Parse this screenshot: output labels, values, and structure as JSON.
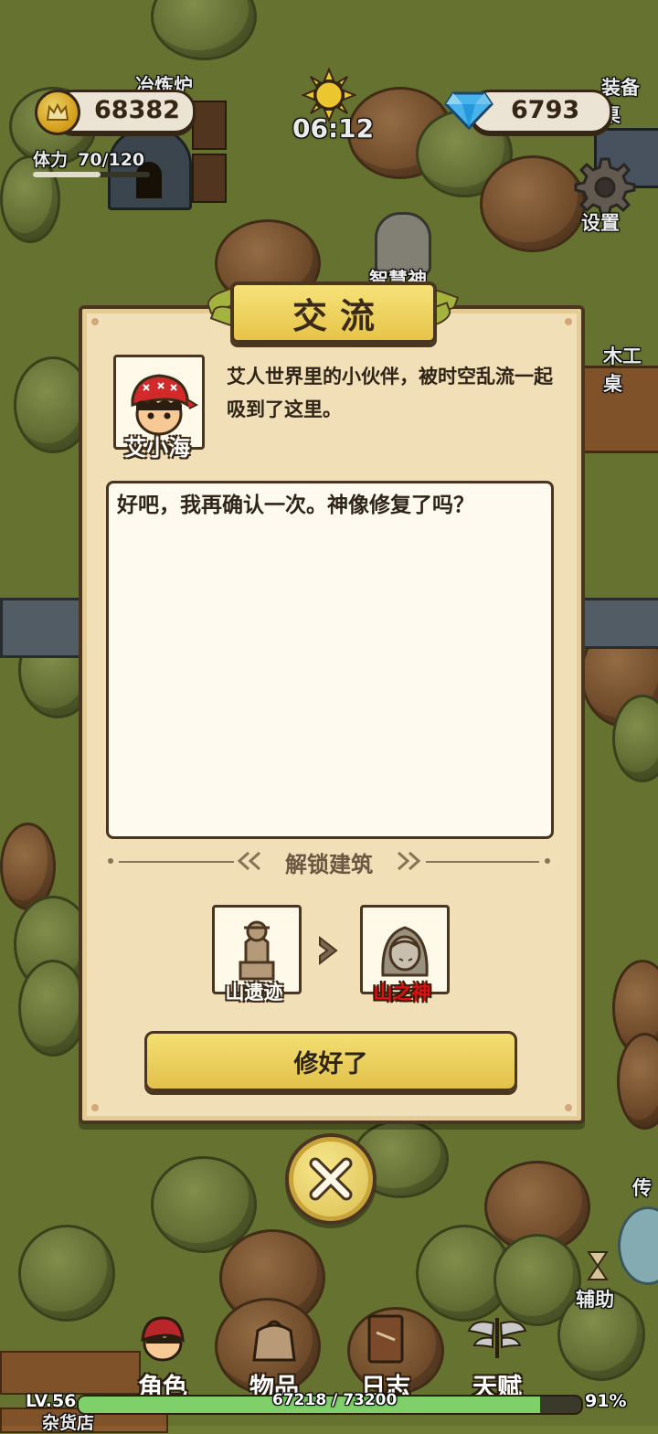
{
  "hud": {
    "gold": "68382",
    "gems": "6793",
    "time": "06:12",
    "stamina_label": "体力",
    "stamina_value": "70/120",
    "stamina_fraction": 0.58
  },
  "map_labels": {
    "smelter": "冶炼炉",
    "equipment_table": "装备桌",
    "settings": "设置",
    "wisdom_god": "智慧神",
    "carpentry": "木工桌",
    "teleport": "传",
    "assist": "辅助",
    "shop": "杂货店"
  },
  "dialog": {
    "title": "交流",
    "character_name": "艾小海",
    "description": "艾人世界里的小伙伴，被时空乱流一起吸到了这里。",
    "message": "好吧，我再确认一次。神像修复了吗？",
    "unlock_label": "解锁建筑",
    "from_building": "山遗迹",
    "to_building": "山之神",
    "confirm_label": "修好了"
  },
  "bottom_nav": {
    "items": [
      {
        "label": "角色",
        "icon": "character-icon"
      },
      {
        "label": "物品",
        "icon": "bag-icon"
      },
      {
        "label": "日志",
        "icon": "journal-icon"
      },
      {
        "label": "天赋",
        "icon": "wings-icon"
      }
    ]
  },
  "status": {
    "level": "LV.56",
    "xp": "67218 / 73200",
    "battery": "91%",
    "xp_fraction": 0.918
  }
}
